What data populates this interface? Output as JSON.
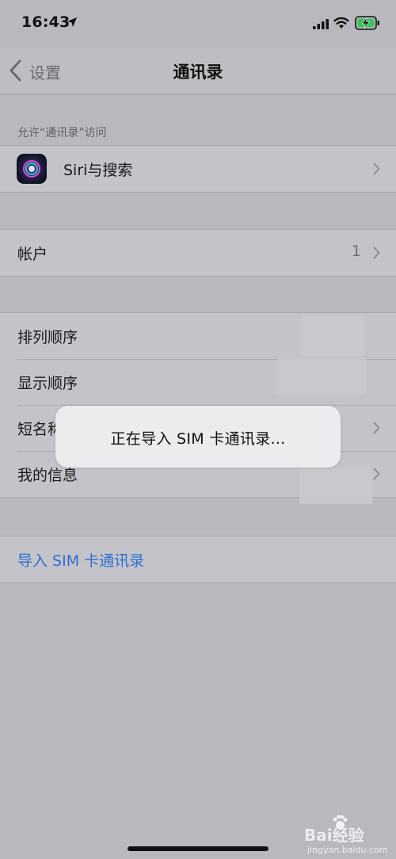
{
  "status_bar": {
    "time": "16:43"
  },
  "nav": {
    "back_label": "设置",
    "title": "通讯录"
  },
  "section_header": "允许“通讯录”访问",
  "siri_row": {
    "label": "Siri与搜索"
  },
  "accounts_row": {
    "label": "帐户",
    "value": "1"
  },
  "settings_rows": [
    {
      "label": "排列顺序"
    },
    {
      "label": "显示顺序"
    },
    {
      "label": "短名称"
    },
    {
      "label": "我的信息"
    }
  ],
  "import_row": {
    "label": "导入 SIM 卡通讯录"
  },
  "toast": {
    "text": "正在导入 SIM 卡通讯录..."
  },
  "watermark": {
    "text": "Bai经验",
    "sub": "jingyan.baidu.com"
  },
  "colors": {
    "background": "#b9b8be",
    "link": "#2d6fd1",
    "battery_charging": "#3cc45a"
  },
  "icons": [
    "location-arrow-icon",
    "cellular-signal-icon",
    "wifi-icon",
    "battery-charging-icon",
    "back-chevron-icon",
    "siri-icon",
    "chevron-right-icon",
    "paw-icon"
  ]
}
